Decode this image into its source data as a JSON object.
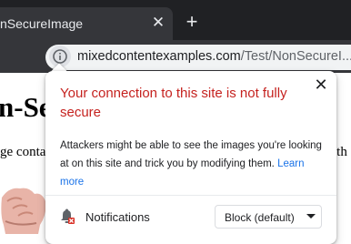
{
  "tab": {
    "title": "nSecureImage",
    "close_icon": "close-icon"
  },
  "toolbar": {
    "new_tab_icon": "plus-icon",
    "site_info_icon": "info-icon",
    "url_domain": "mixedcontentexamples.com",
    "url_path": "/Test/NonSecureI..."
  },
  "page": {
    "heading": "n-Se",
    "line1": "ge conta",
    "line2": "ith"
  },
  "popup": {
    "title": "Your connection to this site is not fully secure",
    "body": "Attackers might be able to see the images you're looking at on this site and trick you by modifying them.",
    "learn_more": "Learn more",
    "close_icon": "close-icon",
    "title_color": "#c5221f",
    "link_color": "#1a73e8",
    "permission": {
      "icon": "bell-blocked-icon",
      "label": "Notifications",
      "value": "Block (default)"
    }
  }
}
